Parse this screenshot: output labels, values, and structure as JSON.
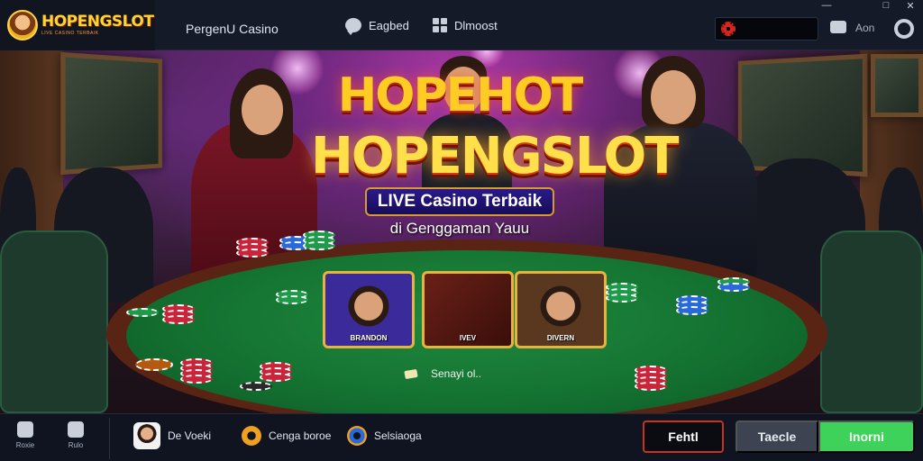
{
  "topbar": {
    "brand_name": "HOPENGSLOT",
    "brand_sub": "LIVE CASINO TERBAIK",
    "title": "PergenU Casino",
    "nav": [
      {
        "label": "Eagbed",
        "icon": "chat-icon"
      },
      {
        "label": "Dlmoost",
        "icon": "grid-icon"
      }
    ],
    "search_placeholder": "",
    "user_label": "Aon",
    "window_controls": [
      "—",
      "□",
      "✕"
    ]
  },
  "hero": {
    "logo_hot": "HOPEHOT",
    "logo_main": "HOPENGSLOT",
    "tagline": "LIVE Casino Terbaik",
    "tagline2": "di Genggaman Yauu",
    "cards": [
      {
        "label": "BRANDON"
      },
      {
        "label": "IVEV"
      },
      {
        "label": "DIVERN"
      }
    ],
    "table_note": "Senayi ol.."
  },
  "bottombar": {
    "side": [
      {
        "label": "Roxie",
        "icon": "home-icon"
      },
      {
        "label": "Rulo",
        "icon": "lock-icon"
      }
    ],
    "players": [
      {
        "label": "De Voeki"
      },
      {
        "label": "Cenga boroe"
      },
      {
        "label": "Selsiaoga"
      }
    ],
    "buttons": {
      "fold": "Fehtl",
      "tackle": "Taecle",
      "normal": "Inorni"
    }
  },
  "colors": {
    "accent_green": "#3fd25a",
    "accent_red": "#c8321e",
    "logo_gold": "#ffcc24",
    "felt_green": "#137030"
  }
}
